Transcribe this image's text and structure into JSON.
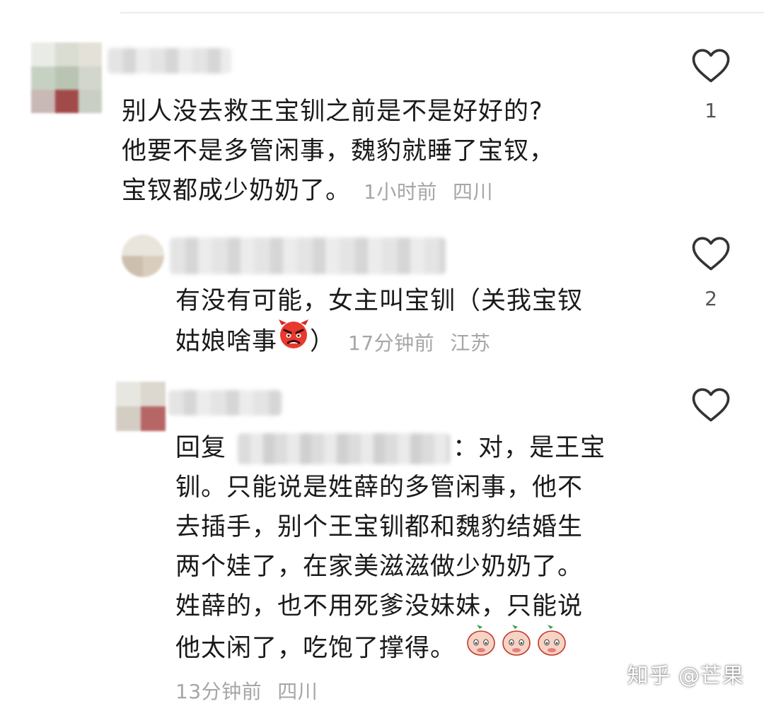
{
  "comments": [
    {
      "text_lines": [
        "别人没去救王宝钏之前是不是好好的?",
        "他要不是多管闲事，魏豹就睡了宝钗，",
        "宝钗都成少奶奶了。"
      ],
      "time": "1小时前",
      "location": "四川",
      "like_count": "1"
    },
    {
      "text_lines": [
        "有没有可能，女主叫宝钏（关我宝钗",
        "姑娘啥事",
        "）"
      ],
      "emoji": "angry-face-emoji",
      "time": "17分钟前",
      "location": "江苏",
      "like_count": "2"
    },
    {
      "reply_prefix": "回复",
      "text_lines": [
        "：对，是王宝",
        "钏。只能说是姓薛的多管闲事，他不",
        "去插手，别个王宝钏都和魏豹结婚生",
        "两个娃了，在家美滋滋做少奶奶了。",
        "姓薛的，也不用死爹没妹妹，只能说",
        "他太闲了，吃饱了撑得。"
      ],
      "emoji": "peach-sticker-emoji",
      "time": "13分钟前",
      "location": "四川"
    }
  ],
  "icons": {
    "like": "heart-outline-icon"
  },
  "colors": {
    "text": "#1a1a1a",
    "meta": "#a6a6a6",
    "heart": "#333333"
  },
  "watermark": "知乎 @芒果"
}
